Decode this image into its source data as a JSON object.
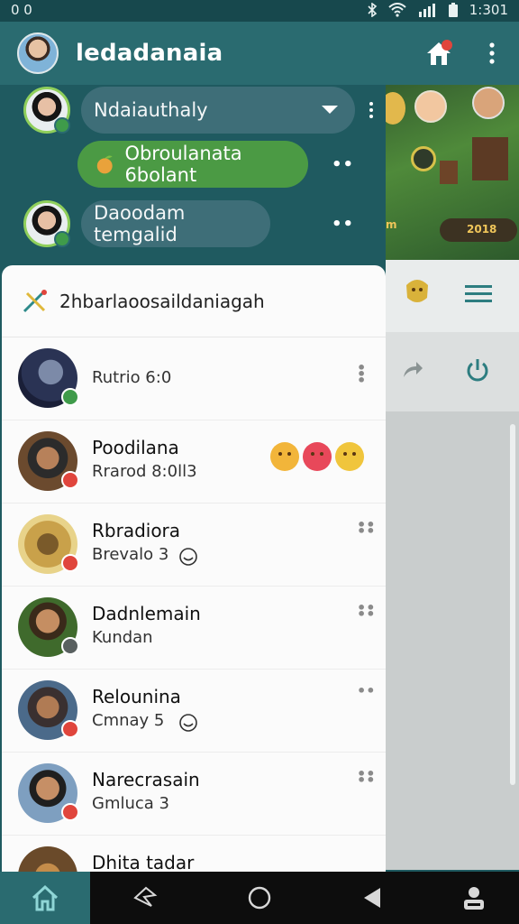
{
  "status_bar": {
    "left_text": "0 0",
    "time": "1:301"
  },
  "app_bar": {
    "title": "ledadanaia",
    "notification_badge_color": "#e0453c"
  },
  "conversations": [
    {
      "text": "Ndaiauthaly",
      "style": "dark"
    },
    {
      "text": "Obroulanata 6bolant",
      "style": "green"
    },
    {
      "text": "Daoodam temgalid",
      "style": "dark"
    }
  ],
  "background_panel": {
    "game_scores": [
      "m",
      "2018"
    ]
  },
  "list": {
    "header": "2hbarlaoosaildaniagah",
    "items": [
      {
        "name": "",
        "sub": "Rutrio 6:0"
      },
      {
        "name": "Poodilana",
        "sub": "Rrarod 8:0ll3"
      },
      {
        "name": "Rbradiora",
        "sub": "Brevalo 3"
      },
      {
        "name": "Dadnlemain",
        "sub": "Kundan"
      },
      {
        "name": "Relounina",
        "sub": "Cmnay 5"
      },
      {
        "name": "Narecrasain",
        "sub": "Gmluca 3"
      },
      {
        "name": "Dhita tadar",
        "sub": ""
      }
    ]
  },
  "colors": {
    "accent": "#2a6b70",
    "green_bubble": "#4b9a44",
    "badge": "#e0453c"
  }
}
